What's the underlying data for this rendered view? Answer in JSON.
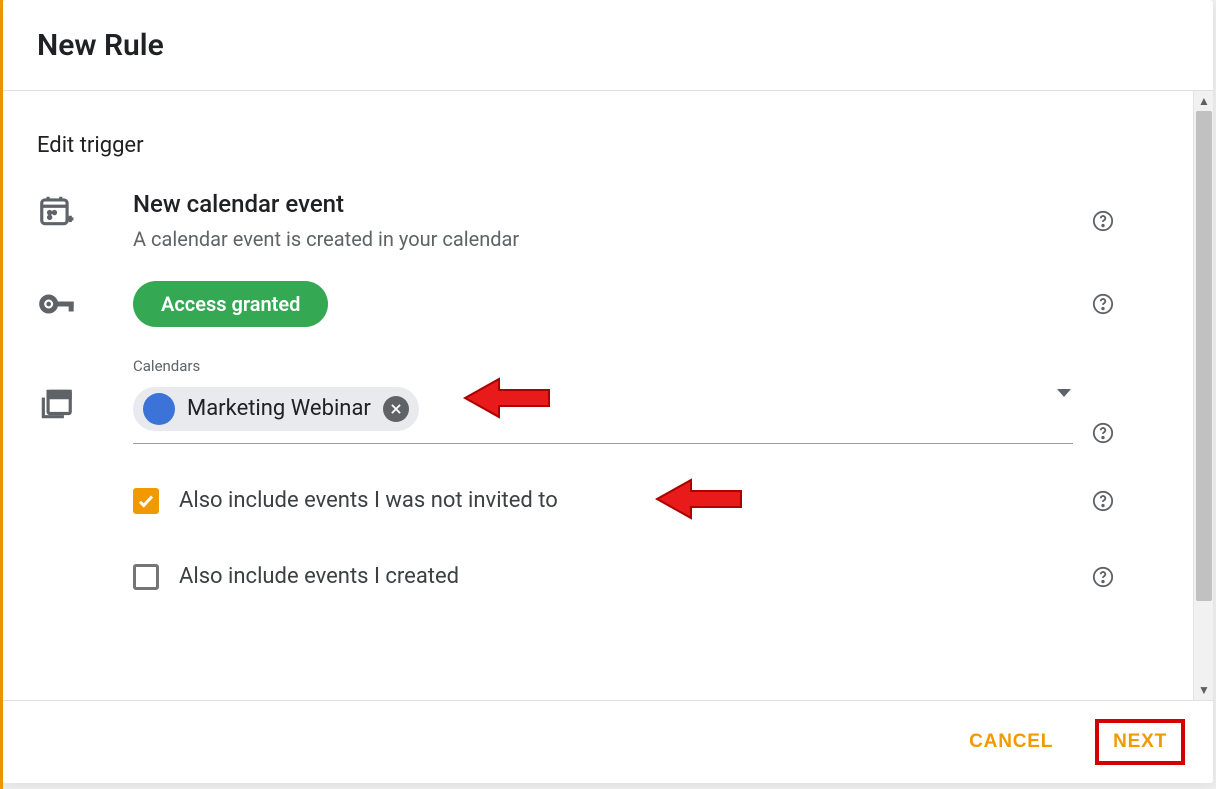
{
  "modal": {
    "title": "New Rule"
  },
  "section": {
    "title": "Edit trigger"
  },
  "trigger": {
    "title": "New calendar event",
    "subtitle": "A calendar event is created in your calendar"
  },
  "access": {
    "label": "Access granted"
  },
  "calendars": {
    "label": "Calendars",
    "chip": {
      "name": "Marketing Webinar",
      "color": "#3b73d8"
    }
  },
  "options": {
    "include_not_invited": {
      "label": "Also include events I was not invited to",
      "checked": true
    },
    "include_created": {
      "label": "Also include events I created",
      "checked": false
    }
  },
  "footer": {
    "cancel": "CANCEL",
    "next": "NEXT"
  },
  "colors": {
    "accent_green": "#34a853",
    "accent_orange": "#f29900",
    "annotation_red": "#d40000"
  }
}
